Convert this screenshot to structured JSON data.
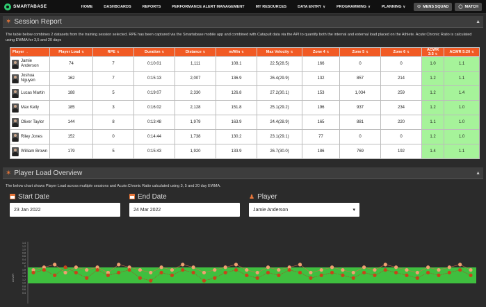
{
  "nav": {
    "logo": "SMARTABASE",
    "items": [
      {
        "label": "HOME",
        "dropdown": false
      },
      {
        "label": "DASHBOARDS",
        "dropdown": false
      },
      {
        "label": "REPORTS",
        "dropdown": false
      },
      {
        "label": "PERFORMANCE ALERT MANAGEMENT",
        "dropdown": false
      },
      {
        "label": "MY RESOURCES",
        "dropdown": false
      },
      {
        "label": "DATA ENTRY",
        "dropdown": true
      },
      {
        "label": "PROGRAMMING",
        "dropdown": true
      },
      {
        "label": "PLANNING",
        "dropdown": true
      }
    ],
    "squad_btn": "MENS SQUAD",
    "match_btn": "MATCH"
  },
  "session": {
    "title": "Session Report",
    "description": "The table below combines 2 datasets from the training session selected. RPE has been captured via the Smartabase mobile app and combined with Catapult data via the API to quantify both the internal and external load placed on the Athlete. Acute:Chronic Ratio is calculated using EWMA for 3,5 and 20 days",
    "columns": [
      "Player",
      "Player Load",
      "RPE",
      "Duration",
      "Distance",
      "m/Min",
      "Max Velocity",
      "Zone 4",
      "Zone 5",
      "Zone 6",
      "ACWR 3:5",
      "ACWR 5:20"
    ],
    "rows": [
      [
        "Jamie Anderson",
        "74",
        "7",
        "0:10:01",
        "1,111",
        "108.1",
        "22.5(28.5)",
        "166",
        "0",
        "0",
        "1.0",
        "1.1"
      ],
      [
        "Joshua Nguyen",
        "162",
        "7",
        "0:15:13",
        "2,007",
        "136.9",
        "26.4(29.9)",
        "132",
        "857",
        "214",
        "1.2",
        "1.1"
      ],
      [
        "Lucas Martin",
        "188",
        "5",
        "0:19:07",
        "2,330",
        "126.8",
        "27.2(30.1)",
        "153",
        "1,034",
        "259",
        "1.2",
        "1.4"
      ],
      [
        "Max Kelly",
        "185",
        "3",
        "0:16:02",
        "2,128",
        "151.8",
        "25.1(29.2)",
        "196",
        "937",
        "234",
        "1.2",
        "1.0"
      ],
      [
        "Oliver Taylor",
        "144",
        "8",
        "0:13:48",
        "1,979",
        "163.9",
        "24.4(28.9)",
        "165",
        "881",
        "220",
        "1.1",
        "1.0"
      ],
      [
        "Riley Jones",
        "152",
        "0",
        "0:14:44",
        "1,738",
        "130.2",
        "23.1(29.1)",
        "77",
        "0",
        "0",
        "1.2",
        "1.0"
      ],
      [
        "William Brown",
        "179",
        "5",
        "0:15:43",
        "1,920",
        "133.9",
        "26.7(30.0)",
        "186",
        "769",
        "192",
        "1.4",
        "1.1"
      ]
    ]
  },
  "load": {
    "title": "Player Load Overview",
    "description": "The below chart shows Player Load across multiple sessions and Acute:Chronic Ratio calculated using 3, 5 and 20 day EWMA.",
    "start_label": "Start Date",
    "start_value": "23 Jan 2022",
    "end_label": "End Date",
    "end_value": "24 Mar 2022",
    "player_label": "Player",
    "player_value": "Jamie Anderson"
  },
  "colors": {
    "accent": "#f15a24",
    "band": "#3fbf3f",
    "dot": "#c8441a",
    "dot_light": "#f0a070"
  },
  "chart_data": {
    "type": "scatter",
    "ylabel": "ACWR",
    "y_ticks": [
      "1.4",
      "1.2",
      "1.0",
      "0.8",
      "0.6",
      "0.4",
      "0.2",
      "0",
      "1.8",
      "1.6",
      "1.4",
      "1.2",
      "1.0",
      "0.8",
      "0.6",
      "0.4"
    ],
    "band": [
      0.8,
      1.3
    ],
    "ylim": [
      0.4,
      2.2
    ],
    "series": [
      {
        "values": [
          1.1,
          1.2,
          1.3,
          1.0,
          1.2,
          1.1,
          1.2,
          1.0,
          1.3,
          1.2,
          1.1,
          1.0,
          1.2,
          1.1,
          1.3,
          1.2,
          1.0,
          1.1,
          1.2,
          1.3,
          1.1,
          1.0,
          1.2,
          1.1,
          1.2,
          1.3,
          1.0,
          1.1,
          1.2,
          1.1,
          1.0,
          1.2,
          1.1,
          1.3,
          1.2,
          1.1,
          1.0,
          1.2,
          1.1,
          1.2,
          1.3,
          1.1
        ]
      },
      {
        "values": [
          1.0,
          1.1,
          0.9,
          1.2,
          1.0,
          0.8,
          1.1,
          0.9,
          1.0,
          1.1,
          0.8,
          0.7,
          1.0,
          0.9,
          1.1,
          1.0,
          0.7,
          0.8,
          1.0,
          1.1,
          0.9,
          0.8,
          1.0,
          0.9,
          1.1,
          1.0,
          0.8,
          0.9,
          1.0,
          0.9,
          0.8,
          1.0,
          0.9,
          1.1,
          1.0,
          0.9,
          0.8,
          1.0,
          0.9,
          1.0,
          1.1,
          0.9
        ]
      }
    ]
  }
}
